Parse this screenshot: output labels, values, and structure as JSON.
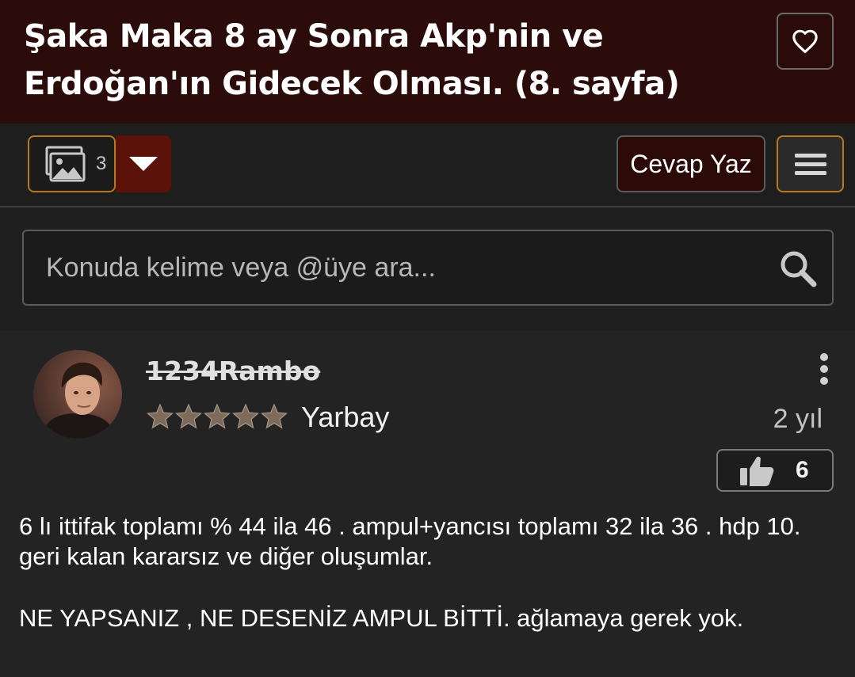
{
  "thread": {
    "title": "Şaka Maka 8 ay Sonra Akp'nin ve Erdoğan'ın Gidecek Olması. (8. sayfa)"
  },
  "toolbar": {
    "images_count": "3",
    "reply_label": "Cevap Yaz"
  },
  "search": {
    "placeholder": "Konuda kelime veya @üye ara..."
  },
  "post": {
    "username": "1234Rambo",
    "rank": "Yarbay",
    "stars": 5,
    "time": "2 yıl",
    "likes": "6",
    "paragraphs": [
      "6 lı ittifak toplamı % 44 ila 46 . ampul+yancısı toplamı 32 ila 36 . hdp 10. geri kalan kararsız ve diğer oluşumlar.",
      "NE YAPSANIZ , NE DESENİZ AMPUL BİTTİ. ağlamaya gerek yok."
    ]
  },
  "colors": {
    "header_bg": "#2c0c0a",
    "accent_border": "#b8781f",
    "dropdown_bg": "#5a1209",
    "page_bg": "#1f1f1f"
  },
  "icons": [
    "heart-icon",
    "image-gallery-icon",
    "chevron-down-icon",
    "hamburger-menu-icon",
    "search-icon",
    "more-vertical-icon",
    "thumbs-up-icon",
    "star-icon"
  ]
}
